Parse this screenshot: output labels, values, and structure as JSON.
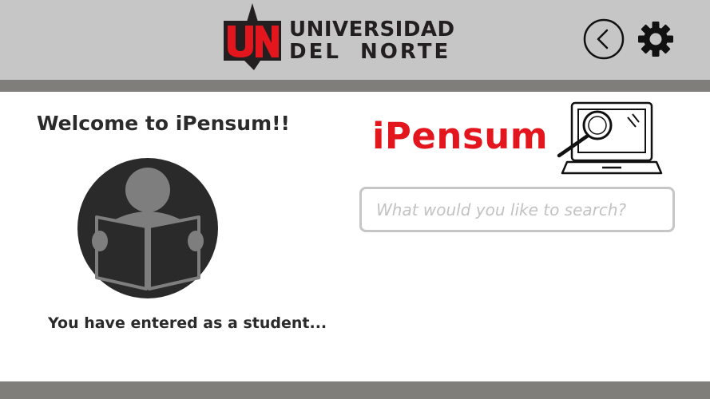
{
  "header": {
    "logo_mark": "UN",
    "logo_line1": "UNIVERSIDAD",
    "logo_line2": "DEL  NORTE",
    "back_icon": "chevron-left-circle-icon",
    "settings_icon": "gear-icon"
  },
  "welcome": {
    "title": "Welcome to iPensum!!",
    "caption": "You have entered as a student...",
    "avatar_icon": "student-reading-icon"
  },
  "brand": {
    "name": "iPensum",
    "icon": "laptop-search-icon"
  },
  "search": {
    "placeholder": "What would you like to search?",
    "value": ""
  },
  "colors": {
    "header_bg": "#c6c6c6",
    "rule": "#7f7e7b",
    "brand_red": "#e3151d",
    "dark": "#2b2b2b"
  }
}
